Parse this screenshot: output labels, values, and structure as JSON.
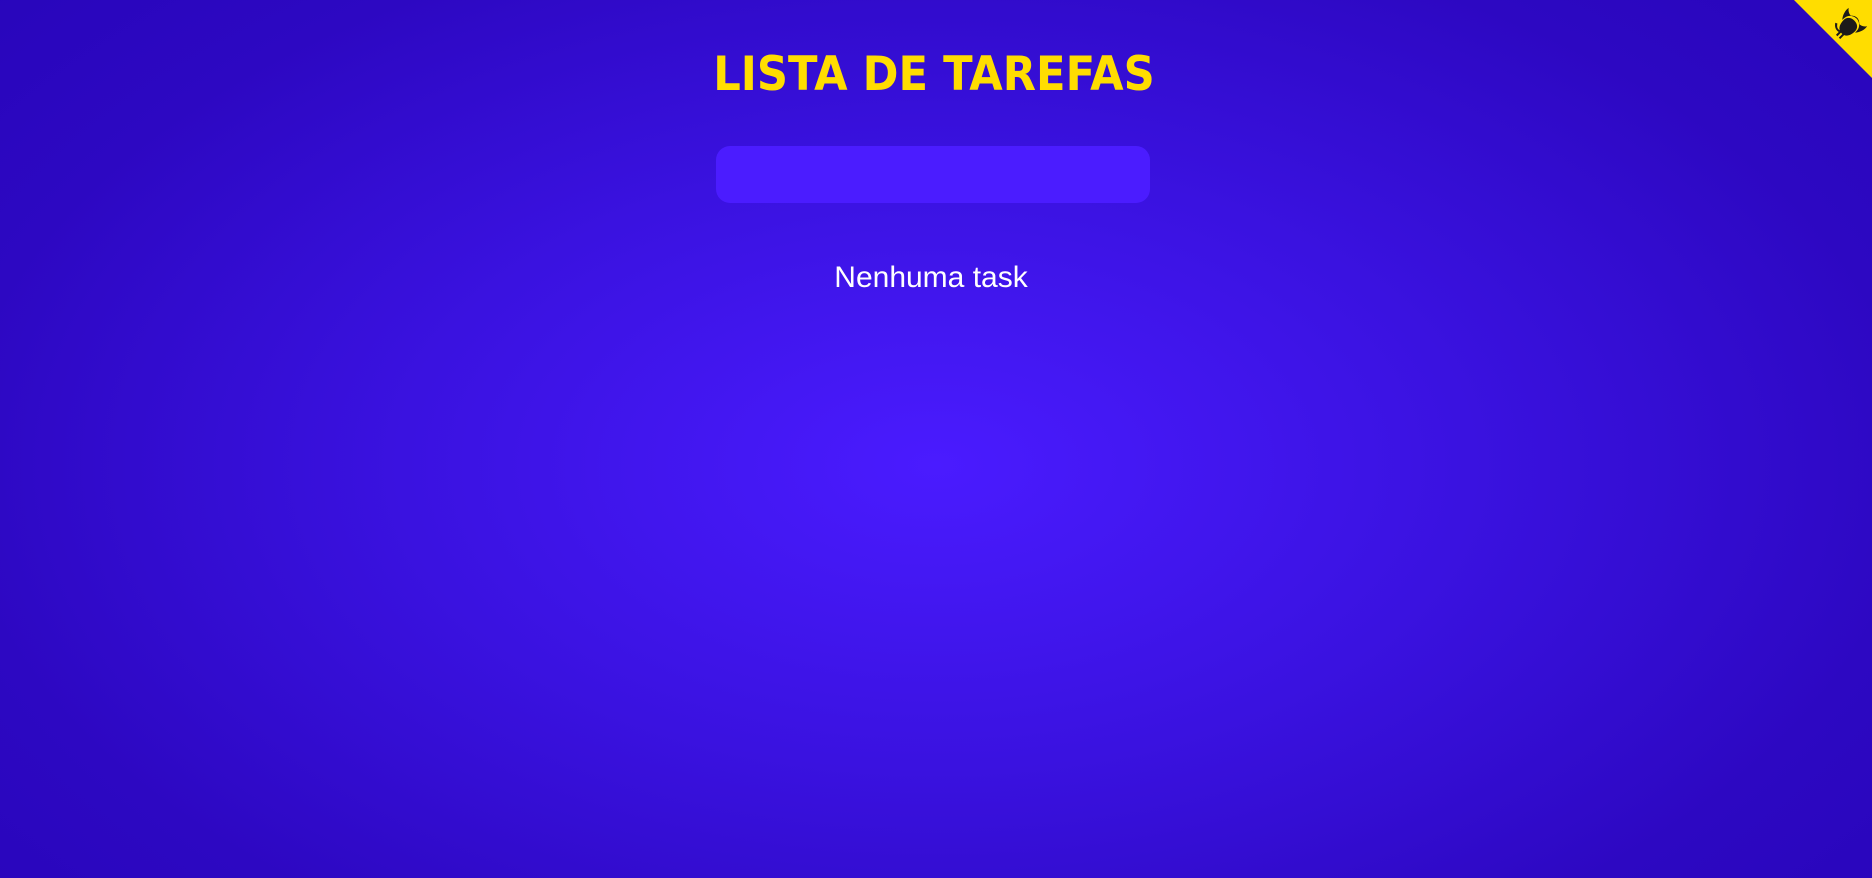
{
  "header": {
    "title": "LISTA DE TAREFAS"
  },
  "task_input": {
    "value": "",
    "placeholder": ""
  },
  "task_list": {
    "empty_message": "Nenhuma task",
    "items": []
  },
  "corner_link": {
    "icon": "github-octocat-icon"
  },
  "colors": {
    "background_center": "#4a1bff",
    "background_edge": "#2604b8",
    "title": "#ffdd00",
    "input_background": "#4b1cff",
    "corner_ribbon": "#ffdd00",
    "corner_icon": "#1c1a1a",
    "text": "#ffffff"
  }
}
